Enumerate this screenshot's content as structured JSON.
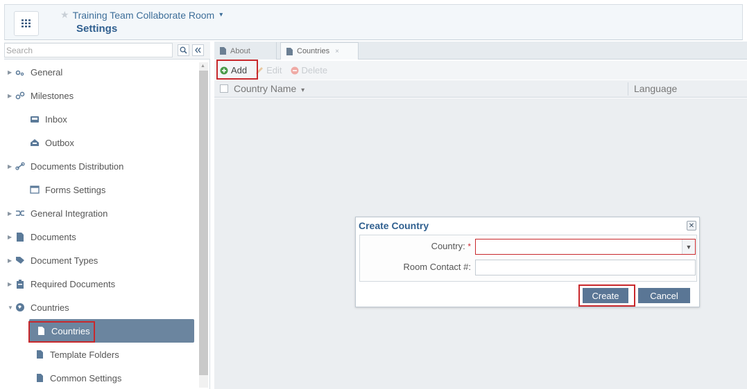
{
  "header": {
    "menu_icon": "grid-icon",
    "room_name": "Training Team Collaborate Room",
    "room_caret": "▾",
    "star_icon": "star-icon",
    "page_title": "Settings"
  },
  "sidebar": {
    "search_placeholder": "Search",
    "items": [
      {
        "label": "General",
        "icon": "gears-icon",
        "expandable": true
      },
      {
        "label": "Milestones",
        "icon": "milestones-icon",
        "expandable": true
      },
      {
        "label": "Inbox",
        "icon": "inbox-icon",
        "expandable": false
      },
      {
        "label": "Outbox",
        "icon": "outbox-icon",
        "expandable": false
      },
      {
        "label": "Documents Distribution",
        "icon": "link-icon",
        "expandable": true
      },
      {
        "label": "Forms Settings",
        "icon": "form-icon",
        "expandable": false
      },
      {
        "label": "General Integration",
        "icon": "integration-icon",
        "expandable": true
      },
      {
        "label": "Documents",
        "icon": "document-icon",
        "expandable": true
      },
      {
        "label": "Document Types",
        "icon": "tag-icon",
        "expandable": true
      },
      {
        "label": "Required Documents",
        "icon": "clipboard-icon",
        "expandable": true
      },
      {
        "label": "Countries",
        "icon": "globe-icon",
        "expandable": true,
        "expanded": true
      },
      {
        "label": "Countries",
        "icon": "document-icon",
        "selected": true
      },
      {
        "label": "Template Folders",
        "icon": "document-icon"
      },
      {
        "label": "Common Settings",
        "icon": "document-icon"
      }
    ]
  },
  "tabs": [
    {
      "label": "About",
      "icon": "document-icon"
    },
    {
      "label": "Countries",
      "icon": "document-icon",
      "close": "×",
      "active": true
    }
  ],
  "toolbar": {
    "add_label": "Add",
    "edit_label": "Edit",
    "delete_label": "Delete"
  },
  "grid": {
    "columns": [
      "Country Name",
      "Language"
    ],
    "sort_indicator": "▾"
  },
  "dialog": {
    "title": "Create Country",
    "country_label": "Country:",
    "required_mark": "*",
    "contact_label": "Room Contact #:",
    "country_value": "",
    "contact_value": "",
    "create_label": "Create",
    "cancel_label": "Cancel"
  },
  "colors": {
    "accent": "#2f5f8f",
    "selected_bg": "#6b859f",
    "highlight_red": "#c8282c",
    "button_bg": "#5a7695"
  }
}
